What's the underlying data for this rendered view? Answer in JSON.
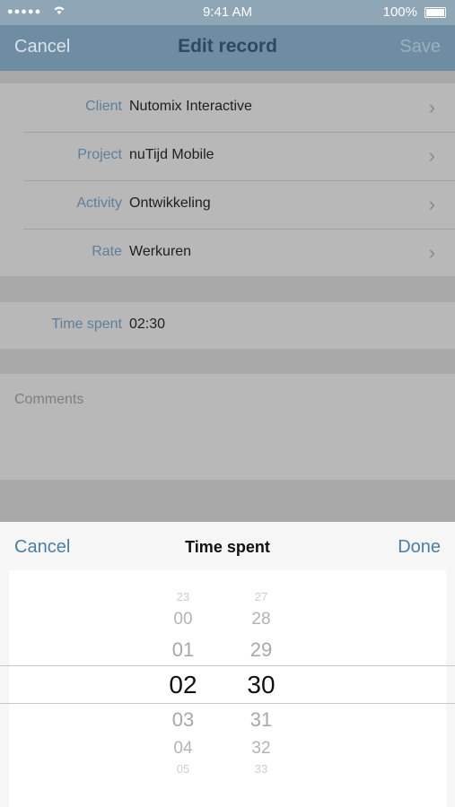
{
  "status_bar": {
    "signal": "●●●●●",
    "wifi": "wifi",
    "time": "9:41 AM",
    "battery": "100%"
  },
  "navbar": {
    "cancel_label": "Cancel",
    "title": "Edit record",
    "save_label": "Save"
  },
  "form": {
    "rows": [
      {
        "label": "Client",
        "value": "Nutomix Interactive"
      },
      {
        "label": "Project",
        "value": "nuTijd Mobile"
      },
      {
        "label": "Activity",
        "value": "Ontwikkeling"
      },
      {
        "label": "Rate",
        "value": "Werkuren"
      }
    ],
    "time_spent": {
      "label": "Time spent",
      "value": "02:30"
    },
    "comments_placeholder": "Comments"
  },
  "sheet": {
    "cancel_label": "Cancel",
    "title": "Time spent",
    "done_label": "Done",
    "hours": [
      "23",
      "00",
      "01",
      "02",
      "03",
      "04",
      "05"
    ],
    "minutes": [
      "27",
      "28",
      "29",
      "30",
      "31",
      "32",
      "33"
    ],
    "selected_hour": "02",
    "selected_minute": "30"
  }
}
